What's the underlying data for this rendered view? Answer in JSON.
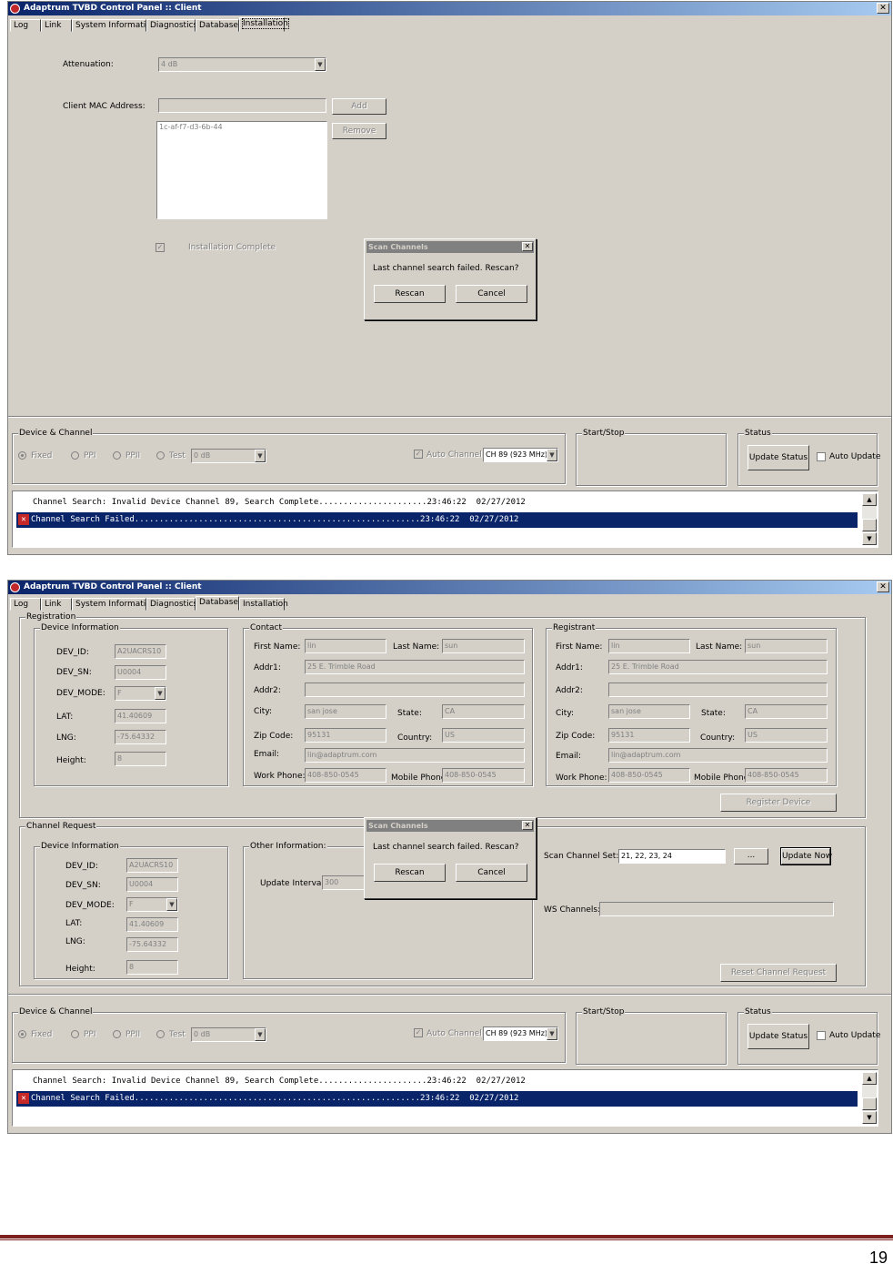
{
  "window1": {
    "title": "Adaptrum TVBD Control Panel :: Client",
    "tabs": [
      "Log",
      "Link",
      "System Information",
      "Diagnostics",
      "Database",
      "Installation"
    ],
    "active_tab": "Installation",
    "installation": {
      "attenuation_label": "Attenuation:",
      "attenuation_value": "4 dB",
      "mac_label": "Client MAC Address:",
      "mac_input_value": "",
      "add_button": "Add",
      "remove_button": "Remove",
      "mac_list": [
        "1c-af-f7-d3-6b-44"
      ],
      "install_complete_label": "Installation Complete",
      "install_complete_checked": true
    }
  },
  "window2": {
    "title": "Adaptrum TVBD Control Panel :: Client",
    "tabs": [
      "Log",
      "Link",
      "System Information",
      "Diagnostics",
      "Database",
      "Installation"
    ],
    "active_tab": "Database",
    "registration": {
      "group_title": "Registration",
      "device_info": {
        "title": "Device Information",
        "dev_id_label": "DEV_ID:",
        "dev_id": "A2UACRS10",
        "dev_sn_label": "DEV_SN:",
        "dev_sn": "U0004",
        "dev_mode_label": "DEV_MODE:",
        "dev_mode": "F",
        "lat_label": "LAT:",
        "lat": "41.40609",
        "lng_label": "LNG:",
        "lng": "-75.64332",
        "height_label": "Height:",
        "height": "8"
      },
      "contact": {
        "title": "Contact",
        "first_name_label": "First Name:",
        "first_name": "lin",
        "last_name_label": "Last Name:",
        "last_name": "sun",
        "addr1_label": "Addr1:",
        "addr1": "25 E. Trimble Road",
        "addr2_label": "Addr2:",
        "addr2": "",
        "city_label": "City:",
        "city": "san jose",
        "state_label": "State:",
        "state": "CA",
        "zip_label": "Zip Code:",
        "zip": "95131",
        "country_label": "Country:",
        "country": "US",
        "email_label": "Email:",
        "email": "lin@adaptrum.com",
        "work_phone_label": "Work Phone:",
        "work_phone": "408-850-0545",
        "mobile_phone_label": "Mobile Phone:",
        "mobile_phone": "408-850-0545"
      },
      "registrant": {
        "title": "Registrant",
        "first_name_label": "First Name:",
        "first_name": "lin",
        "last_name_label": "Last Name:",
        "last_name": "sun",
        "addr1_label": "Addr1:",
        "addr1": "25 E. Trimble Road",
        "addr2_label": "Addr2:",
        "addr2": "",
        "city_label": "City:",
        "city": "san jose",
        "state_label": "State:",
        "state": "CA",
        "zip_label": "Zip Code:",
        "zip": "95131",
        "country_label": "Country:",
        "country": "US",
        "email_label": "Email:",
        "email": "lin@adaptrum.com",
        "work_phone_label": "Work Phone:",
        "work_phone": "408-850-0545",
        "mobile_phone_label": "Mobile Phone:",
        "mobile_phone": "408-850-0545"
      },
      "register_button": "Register Device"
    },
    "channel_request": {
      "group_title": "Channel Request",
      "device_info": {
        "title": "Device Information",
        "dev_id_label": "DEV_ID:",
        "dev_id": "A2UACRS10",
        "dev_sn_label": "DEV_SN:",
        "dev_sn": "U0004",
        "dev_mode_label": "DEV_MODE:",
        "dev_mode": "F",
        "lat_label": "LAT:",
        "lat": "41.40609",
        "lng_label": "LNG:",
        "lng": "-75.64332",
        "height_label": "Height:",
        "height": "8"
      },
      "other_info_title": "Other Information:",
      "update_interval_label": "Update Interval:",
      "update_interval": "300",
      "scan_channel_set_label": "Scan Channel Set:",
      "scan_channel_set": "21, 22, 23, 24",
      "browse_button": "...",
      "update_now_button": "Update Now",
      "ws_channels_label": "WS Channels:",
      "ws_channels": "",
      "reset_button": "Reset Channel Request"
    }
  },
  "bottom_panel": {
    "device_channel_title": "Device & Channel",
    "radio_fixed": "Fixed",
    "radio_ppi": "PPI",
    "radio_ppii": "PPII",
    "radio_test": "Test",
    "test_value": "0 dB",
    "auto_channel_label": "Auto Channel",
    "channel_value": "CH 89 (923 MHz)",
    "start_stop_title": "Start/Stop",
    "status_title": "Status",
    "update_status_button": "Update Status",
    "auto_update_label": "Auto Update",
    "log_lines": [
      "Channel Search: Invalid Device Channel 89, Search Complete......................23:46:22  02/27/2012",
      "Channel Search Failed..........................................................23:46:22  02/27/2012"
    ]
  },
  "dialog": {
    "title": "Scan Channels",
    "message": "Last channel search failed. Rescan?",
    "rescan_button": "Rescan",
    "cancel_button": "Cancel"
  },
  "page_number": "19",
  "colors": {
    "window_bg": "#d4d0c8",
    "title_active": "#0a246a",
    "selection": "#0a246a",
    "footer_rule": "#7b1f1f"
  }
}
